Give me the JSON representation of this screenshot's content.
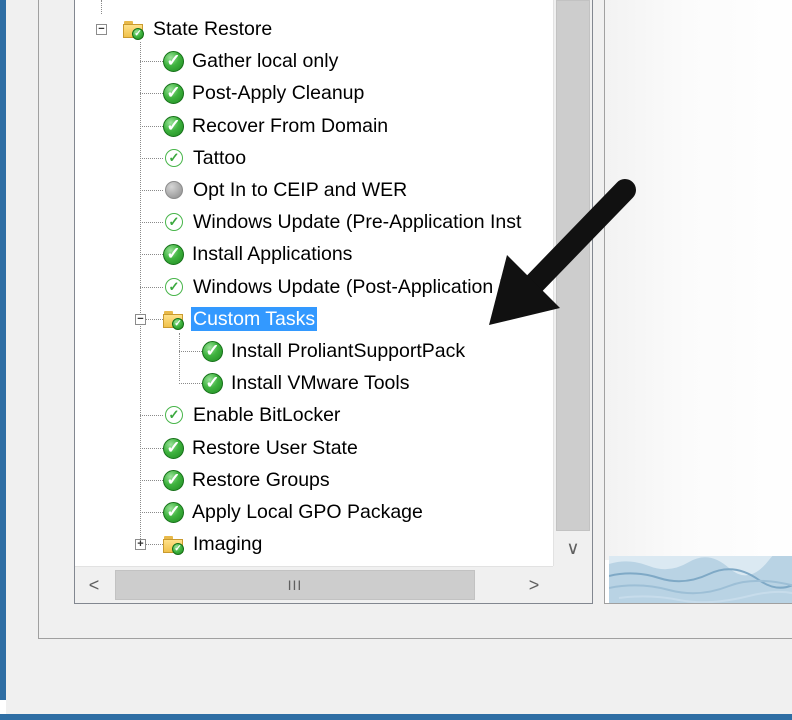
{
  "tree": {
    "nodes": [
      {
        "label": "State Restore",
        "icon": "folder-check-icon",
        "expander": "minus"
      },
      {
        "label": "Gather local only",
        "icon": "green-check-icon"
      },
      {
        "label": "Post-Apply Cleanup",
        "icon": "green-check-icon"
      },
      {
        "label": "Recover From Domain",
        "icon": "green-check-icon"
      },
      {
        "label": "Tattoo",
        "icon": "outline-check-icon"
      },
      {
        "label": "Opt In to CEIP and WER",
        "icon": "disabled-step-icon"
      },
      {
        "label": "Windows Update (Pre-Application Inst",
        "icon": "outline-check-icon"
      },
      {
        "label": "Install Applications",
        "icon": "green-check-icon"
      },
      {
        "label": "Windows Update (Post-Application Ins",
        "icon": "outline-check-icon"
      },
      {
        "label": "Custom Tasks",
        "icon": "folder-check-icon",
        "expander": "minus",
        "selected": true
      },
      {
        "label": "Install ProliantSupportPack",
        "icon": "green-check-icon"
      },
      {
        "label": "Install VMware Tools",
        "icon": "green-check-icon"
      },
      {
        "label": "Enable BitLocker",
        "icon": "outline-check-icon"
      },
      {
        "label": "Restore User State",
        "icon": "green-check-icon"
      },
      {
        "label": "Restore Groups",
        "icon": "green-check-icon"
      },
      {
        "label": "Apply Local GPO Package",
        "icon": "green-check-icon"
      },
      {
        "label": "Imaging",
        "icon": "folder-check-icon",
        "expander": "plus"
      }
    ]
  },
  "scrollbars": {
    "down_glyph": "∨",
    "left_glyph": "<",
    "right_glyph": ">",
    "grip_glyph": "III"
  },
  "colors": {
    "selection": "#3399ff",
    "accent": "#2e6ea4",
    "check_green": "#3fb33f"
  }
}
